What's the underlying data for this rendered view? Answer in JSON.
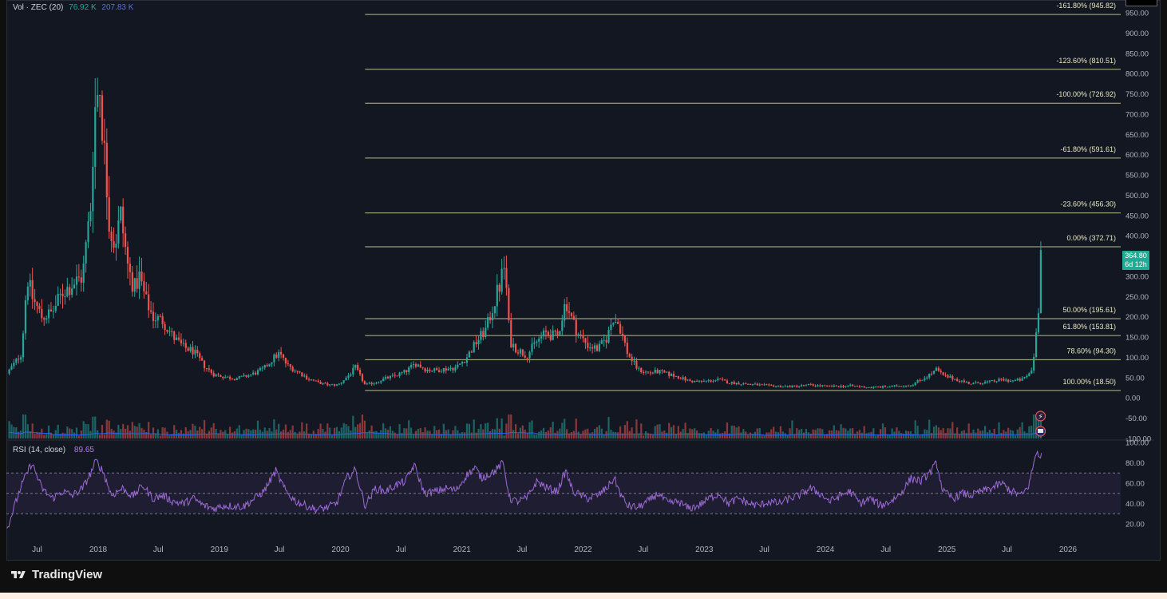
{
  "legends": {
    "vol_name": "Vol · ZEC (20)",
    "vol_value_1": "76.92 K",
    "vol_value_2": "207.83 K",
    "rsi_name": "RSI (14, close)",
    "rsi_value": "89.65"
  },
  "badge": {
    "price": "364.80",
    "countdown": "6d 12h"
  },
  "branding": {
    "logo_text": "TradingView"
  },
  "colors": {
    "background": "#131722",
    "up": "#26a69a",
    "down": "#ef5350",
    "fib": "#d6d7a1",
    "rsi": "#9d6ad6",
    "volume_ma": "#2962ff",
    "price_badge": "#22ab94"
  },
  "chart_data": [
    {
      "type": "candlestick",
      "title": "",
      "pair": "ZEC",
      "ylim": [
        -100,
        950
      ],
      "y_ticks": [
        950,
        900,
        850,
        800,
        750,
        700,
        650,
        600,
        550,
        500,
        450,
        400,
        350,
        300,
        250,
        200,
        150,
        100,
        50,
        0,
        -50,
        -100
      ],
      "y_tick_labels": [
        "950.00",
        "900.00",
        "850.00",
        "800.00",
        "750.00",
        "700.00",
        "650.00",
        "600.00",
        "550.00",
        "500.00",
        "450.00",
        "400.00",
        "350.00",
        "300.00",
        "250.00",
        "200.00",
        "150.00",
        "100.00",
        "50.00",
        "0.00",
        "-50.00",
        "-100.00"
      ],
      "xlim": [
        "2017-04-01",
        "2026-07-01"
      ],
      "x_ticks": [
        {
          "label": "Jul",
          "date": "2017-07-01"
        },
        {
          "label": "2018",
          "date": "2018-01-01"
        },
        {
          "label": "Jul",
          "date": "2018-07-01"
        },
        {
          "label": "2019",
          "date": "2019-01-01"
        },
        {
          "label": "Jul",
          "date": "2019-07-01"
        },
        {
          "label": "2020",
          "date": "2020-01-01"
        },
        {
          "label": "Jul",
          "date": "2020-07-01"
        },
        {
          "label": "2021",
          "date": "2021-01-01"
        },
        {
          "label": "Jul",
          "date": "2021-07-01"
        },
        {
          "label": "2022",
          "date": "2022-01-01"
        },
        {
          "label": "Jul",
          "date": "2022-07-01"
        },
        {
          "label": "2023",
          "date": "2023-01-01"
        },
        {
          "label": "Jul",
          "date": "2023-07-01"
        },
        {
          "label": "2024",
          "date": "2024-01-01"
        },
        {
          "label": "Jul",
          "date": "2024-07-01"
        },
        {
          "label": "2025",
          "date": "2025-01-01"
        },
        {
          "label": "Jul",
          "date": "2025-07-01"
        },
        {
          "label": "2026",
          "date": "2026-01-01"
        }
      ],
      "price_path": [
        [
          "2017-04-01",
          60
        ],
        [
          "2017-05-15",
          110
        ],
        [
          "2017-06-01",
          300
        ],
        [
          "2017-06-15",
          250
        ],
        [
          "2017-07-15",
          200
        ],
        [
          "2017-08-15",
          210
        ],
        [
          "2017-09-15",
          260
        ],
        [
          "2017-10-15",
          280
        ],
        [
          "2017-11-15",
          300
        ],
        [
          "2017-12-10",
          480
        ],
        [
          "2017-12-20",
          700
        ],
        [
          "2018-01-05",
          780
        ],
        [
          "2018-01-20",
          600
        ],
        [
          "2018-02-05",
          420
        ],
        [
          "2018-02-20",
          380
        ],
        [
          "2018-03-10",
          450
        ],
        [
          "2018-04-01",
          320
        ],
        [
          "2018-04-20",
          270
        ],
        [
          "2018-05-05",
          300
        ],
        [
          "2018-05-25",
          240
        ],
        [
          "2018-06-15",
          200
        ],
        [
          "2018-07-15",
          190
        ],
        [
          "2018-08-15",
          150
        ],
        [
          "2018-09-15",
          125
        ],
        [
          "2018-10-15",
          115
        ],
        [
          "2018-11-15",
          80
        ],
        [
          "2018-12-15",
          58
        ],
        [
          "2019-01-15",
          52
        ],
        [
          "2019-02-15",
          48
        ],
        [
          "2019-03-15",
          52
        ],
        [
          "2019-04-15",
          60
        ],
        [
          "2019-05-15",
          72
        ],
        [
          "2019-06-15",
          100
        ],
        [
          "2019-07-01",
          110
        ],
        [
          "2019-07-25",
          80
        ],
        [
          "2019-08-25",
          65
        ],
        [
          "2019-09-25",
          48
        ],
        [
          "2019-10-25",
          38
        ],
        [
          "2019-11-25",
          32
        ],
        [
          "2019-12-25",
          32
        ],
        [
          "2020-01-25",
          55
        ],
        [
          "2020-02-15",
          75
        ],
        [
          "2020-03-15",
          32
        ],
        [
          "2020-04-15",
          38
        ],
        [
          "2020-05-15",
          48
        ],
        [
          "2020-06-15",
          55
        ],
        [
          "2020-07-15",
          65
        ],
        [
          "2020-08-15",
          85
        ],
        [
          "2020-09-15",
          70
        ],
        [
          "2020-10-15",
          68
        ],
        [
          "2020-11-15",
          72
        ],
        [
          "2020-12-15",
          75
        ],
        [
          "2021-01-15",
          100
        ],
        [
          "2021-02-15",
          140
        ],
        [
          "2021-03-15",
          170
        ],
        [
          "2021-04-10",
          240
        ],
        [
          "2021-04-25",
          280
        ],
        [
          "2021-05-10",
          330
        ],
        [
          "2021-05-25",
          140
        ],
        [
          "2021-06-15",
          120
        ],
        [
          "2021-07-15",
          105
        ],
        [
          "2021-08-15",
          140
        ],
        [
          "2021-09-10",
          160
        ],
        [
          "2021-10-15",
          150
        ],
        [
          "2021-11-10",
          240
        ],
        [
          "2021-11-25",
          200
        ],
        [
          "2021-12-15",
          160
        ],
        [
          "2022-01-15",
          130
        ],
        [
          "2022-02-15",
          120
        ],
        [
          "2022-03-15",
          150
        ],
        [
          "2022-04-01",
          200
        ],
        [
          "2022-04-20",
          180
        ],
        [
          "2022-05-15",
          110
        ],
        [
          "2022-06-15",
          70
        ],
        [
          "2022-07-15",
          62
        ],
        [
          "2022-08-15",
          65
        ],
        [
          "2022-09-15",
          58
        ],
        [
          "2022-10-15",
          52
        ],
        [
          "2022-11-15",
          42
        ],
        [
          "2022-12-15",
          40
        ],
        [
          "2023-01-15",
          42
        ],
        [
          "2023-02-15",
          45
        ],
        [
          "2023-03-15",
          38
        ],
        [
          "2023-05-15",
          34
        ],
        [
          "2023-07-15",
          30
        ],
        [
          "2023-09-15",
          28
        ],
        [
          "2023-11-15",
          32
        ],
        [
          "2024-01-15",
          28
        ],
        [
          "2024-03-15",
          30
        ],
        [
          "2024-05-15",
          26
        ],
        [
          "2024-07-15",
          28
        ],
        [
          "2024-09-15",
          32
        ],
        [
          "2024-10-15",
          45
        ],
        [
          "2024-11-15",
          60
        ],
        [
          "2024-12-01",
          70
        ],
        [
          "2024-12-20",
          55
        ],
        [
          "2025-01-20",
          48
        ],
        [
          "2025-03-15",
          35
        ],
        [
          "2025-05-15",
          40
        ],
        [
          "2025-06-15",
          45
        ],
        [
          "2025-07-15",
          42
        ],
        [
          "2025-08-15",
          45
        ],
        [
          "2025-09-01",
          55
        ],
        [
          "2025-09-15",
          70
        ],
        [
          "2025-09-25",
          140
        ],
        [
          "2025-10-01",
          200
        ],
        [
          "2025-10-08",
          260
        ],
        [
          "2025-10-15",
          364.8
        ]
      ],
      "last_price": 364.8,
      "fibonacci": {
        "start_date": "2020-03-15",
        "end_date": "2026-03-15",
        "levels": [
          {
            "label": "-161.80% (945.82)",
            "value": 945.82
          },
          {
            "label": "-123.60% (810.51)",
            "value": 810.51
          },
          {
            "label": "-100.00% (726.92)",
            "value": 726.92
          },
          {
            "label": "-61.80% (591.61)",
            "value": 591.61
          },
          {
            "label": "-23.60% (456.30)",
            "value": 456.3
          },
          {
            "label": "0.00% (372.71)",
            "value": 372.71
          },
          {
            "label": "50.00% (195.61)",
            "value": 195.61
          },
          {
            "label": "61.80% (153.81)",
            "value": 153.81
          },
          {
            "label": "78.60% (94.30)",
            "value": 94.3
          },
          {
            "label": "100.00% (18.50)",
            "value": 18.5
          }
        ]
      }
    },
    {
      "type": "line",
      "title": "",
      "indicator": "RSI",
      "ylim": [
        10,
        100
      ],
      "y_ticks": [
        100,
        80,
        60,
        40,
        20
      ],
      "y_tick_labels": [
        "100.00",
        "80.00",
        "60.00",
        "40.00",
        "20.00"
      ],
      "bands": [
        70,
        50,
        30
      ],
      "rsi_path": [
        [
          "2017-04-01",
          15
        ],
        [
          "2017-05-15",
          58
        ],
        [
          "2017-06-15",
          80
        ],
        [
          "2017-07-15",
          55
        ],
        [
          "2017-08-15",
          45
        ],
        [
          "2017-09-15",
          52
        ],
        [
          "2017-10-15",
          48
        ],
        [
          "2017-11-15",
          55
        ],
        [
          "2017-12-10",
          70
        ],
        [
          "2017-12-25",
          82
        ],
        [
          "2018-01-15",
          72
        ],
        [
          "2018-02-10",
          48
        ],
        [
          "2018-03-15",
          55
        ],
        [
          "2018-04-15",
          47
        ],
        [
          "2018-05-15",
          58
        ],
        [
          "2018-06-15",
          45
        ],
        [
          "2018-07-15",
          48
        ],
        [
          "2018-08-15",
          42
        ],
        [
          "2018-09-15",
          40
        ],
        [
          "2018-10-15",
          45
        ],
        [
          "2018-11-15",
          38
        ],
        [
          "2018-12-15",
          35
        ],
        [
          "2019-01-15",
          38
        ],
        [
          "2019-03-15",
          37
        ],
        [
          "2019-05-15",
          52
        ],
        [
          "2019-06-20",
          72
        ],
        [
          "2019-07-20",
          52
        ],
        [
          "2019-08-20",
          42
        ],
        [
          "2019-09-20",
          38
        ],
        [
          "2019-10-20",
          34
        ],
        [
          "2019-11-20",
          36
        ],
        [
          "2019-12-20",
          40
        ],
        [
          "2020-01-20",
          65
        ],
        [
          "2020-02-15",
          73
        ],
        [
          "2020-03-15",
          38
        ],
        [
          "2020-04-15",
          55
        ],
        [
          "2020-05-15",
          52
        ],
        [
          "2020-06-15",
          58
        ],
        [
          "2020-07-15",
          62
        ],
        [
          "2020-08-10",
          78
        ],
        [
          "2020-09-10",
          50
        ],
        [
          "2020-10-15",
          52
        ],
        [
          "2020-11-15",
          55
        ],
        [
          "2020-12-15",
          53
        ],
        [
          "2021-01-15",
          68
        ],
        [
          "2021-02-10",
          75
        ],
        [
          "2021-03-01",
          65
        ],
        [
          "2021-04-10",
          72
        ],
        [
          "2021-05-05",
          80
        ],
        [
          "2021-05-25",
          45
        ],
        [
          "2021-06-15",
          42
        ],
        [
          "2021-07-15",
          45
        ],
        [
          "2021-08-15",
          62
        ],
        [
          "2021-09-15",
          55
        ],
        [
          "2021-10-15",
          52
        ],
        [
          "2021-11-10",
          72
        ],
        [
          "2021-12-01",
          52
        ],
        [
          "2022-01-15",
          45
        ],
        [
          "2022-02-15",
          48
        ],
        [
          "2022-03-15",
          56
        ],
        [
          "2022-04-05",
          65
        ],
        [
          "2022-04-25",
          48
        ],
        [
          "2022-05-15",
          38
        ],
        [
          "2022-06-15",
          36
        ],
        [
          "2022-07-15",
          42
        ],
        [
          "2022-08-15",
          50
        ],
        [
          "2022-09-15",
          40
        ],
        [
          "2022-10-15",
          42
        ],
        [
          "2022-11-15",
          35
        ],
        [
          "2022-12-15",
          38
        ],
        [
          "2023-01-15",
          45
        ],
        [
          "2023-02-15",
          50
        ],
        [
          "2023-03-15",
          40
        ],
        [
          "2023-04-15",
          45
        ],
        [
          "2023-05-15",
          40
        ],
        [
          "2023-06-15",
          38
        ],
        [
          "2023-07-15",
          42
        ],
        [
          "2023-08-15",
          40
        ],
        [
          "2023-09-15",
          45
        ],
        [
          "2023-10-15",
          48
        ],
        [
          "2023-11-15",
          55
        ],
        [
          "2023-12-15",
          50
        ],
        [
          "2024-01-15",
          42
        ],
        [
          "2024-02-15",
          48
        ],
        [
          "2024-03-15",
          52
        ],
        [
          "2024-04-15",
          40
        ],
        [
          "2024-05-15",
          45
        ],
        [
          "2024-06-15",
          38
        ],
        [
          "2024-07-15",
          42
        ],
        [
          "2024-08-15",
          50
        ],
        [
          "2024-09-15",
          65
        ],
        [
          "2024-10-15",
          62
        ],
        [
          "2024-11-15",
          72
        ],
        [
          "2024-12-01",
          80
        ],
        [
          "2024-12-20",
          52
        ],
        [
          "2025-01-20",
          45
        ],
        [
          "2025-02-15",
          50
        ],
        [
          "2025-03-15",
          48
        ],
        [
          "2025-04-15",
          52
        ],
        [
          "2025-05-15",
          55
        ],
        [
          "2025-06-15",
          60
        ],
        [
          "2025-07-15",
          52
        ],
        [
          "2025-08-15",
          48
        ],
        [
          "2025-09-05",
          58
        ],
        [
          "2025-09-20",
          80
        ],
        [
          "2025-09-30",
          92
        ],
        [
          "2025-10-07",
          86
        ],
        [
          "2025-10-15",
          89.65
        ]
      ],
      "last_value": 89.65
    }
  ]
}
